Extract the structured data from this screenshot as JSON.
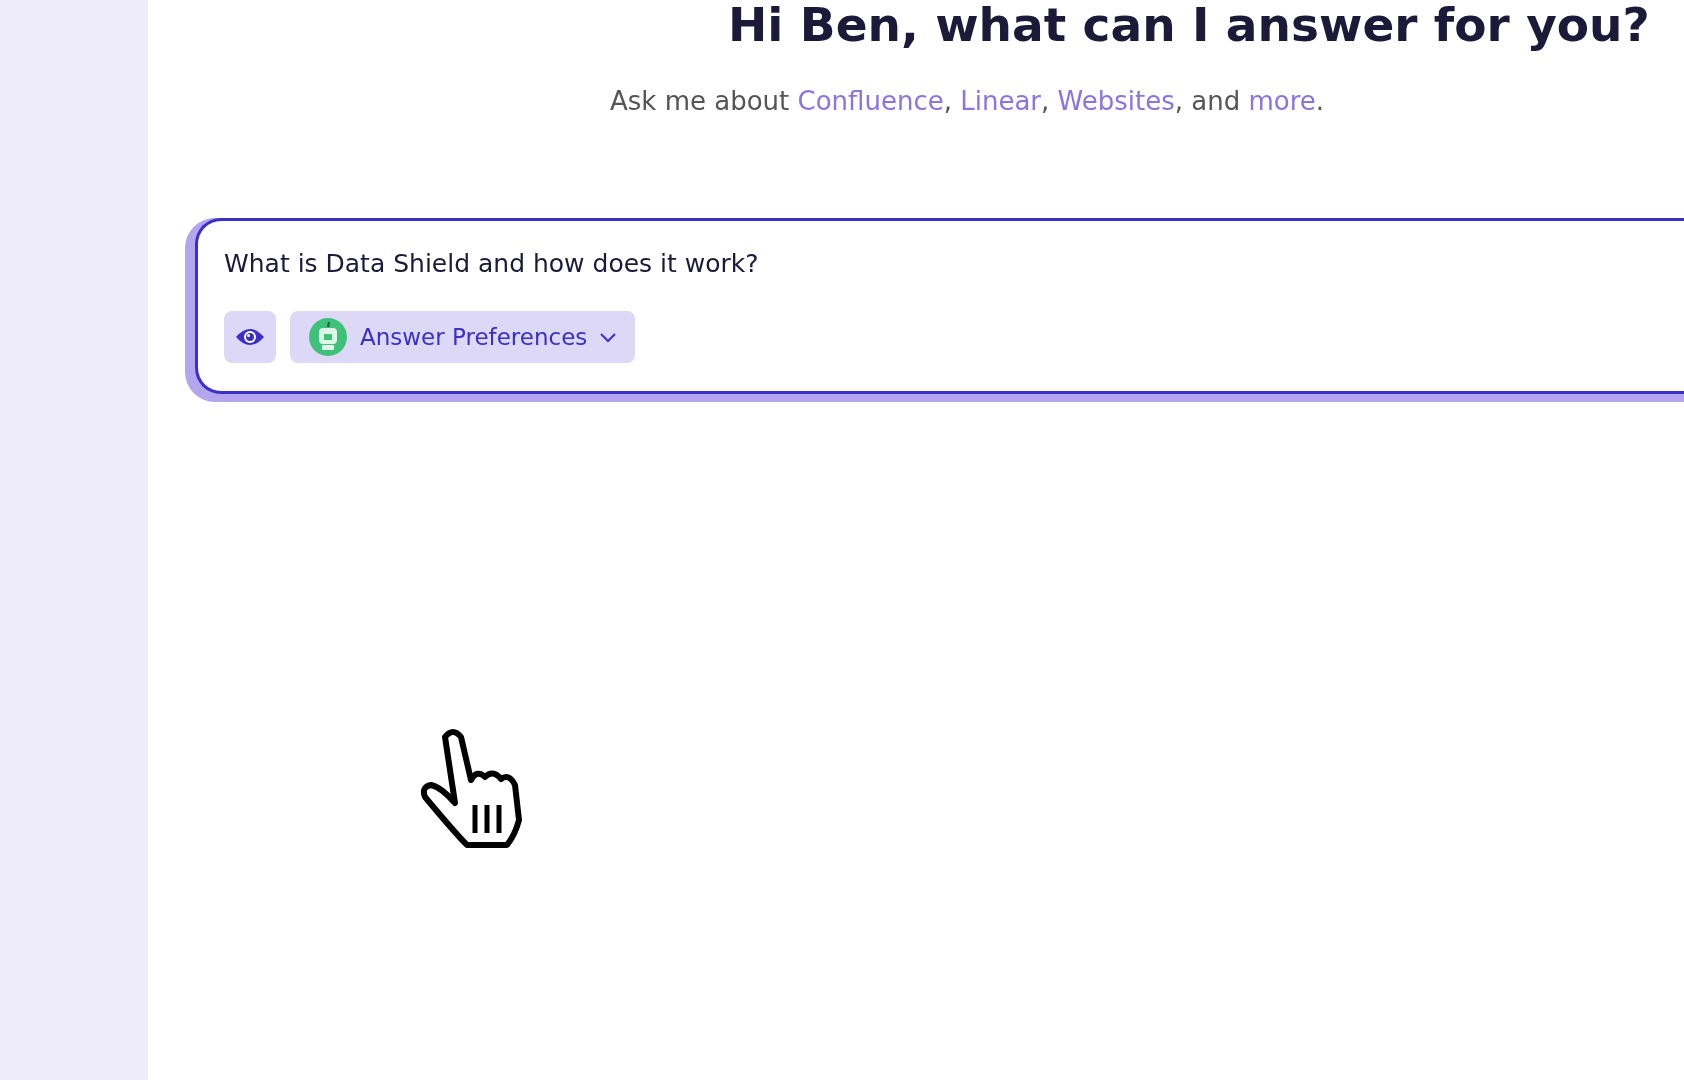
{
  "greeting": "Hi Ben, what can I answer for you?",
  "subtitle": [
    {
      "text": "Ask me about ",
      "link": false
    },
    {
      "text": "Confluence",
      "link": true
    },
    {
      "text": ", ",
      "link": false
    },
    {
      "text": "Linear",
      "link": true
    },
    {
      "text": ", ",
      "link": false
    },
    {
      "text": "Websites",
      "link": true
    },
    {
      "text": ", and ",
      "link": false
    },
    {
      "text": "more",
      "link": true
    },
    {
      "text": ".",
      "link": false
    }
  ],
  "query": {
    "value": "What is Data Shield and how does it work?"
  },
  "preferences": {
    "label": "Answer Preferences"
  }
}
